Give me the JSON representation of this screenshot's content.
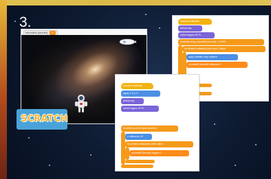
{
  "step": {
    "number": "3."
  },
  "stage": {
    "variable_monitor": {
      "label": "rekordidő (kezdet)",
      "value": "0"
    }
  },
  "logo": {
    "text": "SCRATCH"
  },
  "code_panel_right": {
    "hat": "zászlóra kattintás",
    "b1": "jelenj meg",
    "b2": "méret legyen 50 %",
    "b3": "ismételd amíg rekordidő (kezdet) < 10000",
    "b4": "ha érinted választott pont ikon 3 akkor",
    "b5": "ugorj véletlen hely helyére",
    "b6": "rekordidő (kezdet) változzon 1",
    "v1": "50",
    "v2": "10000",
    "v3": "1"
  },
  "code_panel_left": {
    "hat": "zászlóra kattintás",
    "b1": "ugorj x: 0 y: 0",
    "b2": "jelenj meg",
    "b3": "méret legyen 30 %",
    "b4": "ismételd pozíció lekeresésével",
    "b5": "x változzon 10",
    "b6": "ha érinted választott szélre akkor",
    "b7": "rekordidő (kezdet) legyen 0",
    "v1": "0",
    "v2": "0",
    "v3": "30",
    "v4": "10",
    "v5": "0"
  },
  "colors": {
    "background": "#0d1a30",
    "event": "#f2b312",
    "control": "#f59a1a",
    "looks": "#7b64d8",
    "motion": "#4c8fe4",
    "operator": "#55c85f"
  }
}
